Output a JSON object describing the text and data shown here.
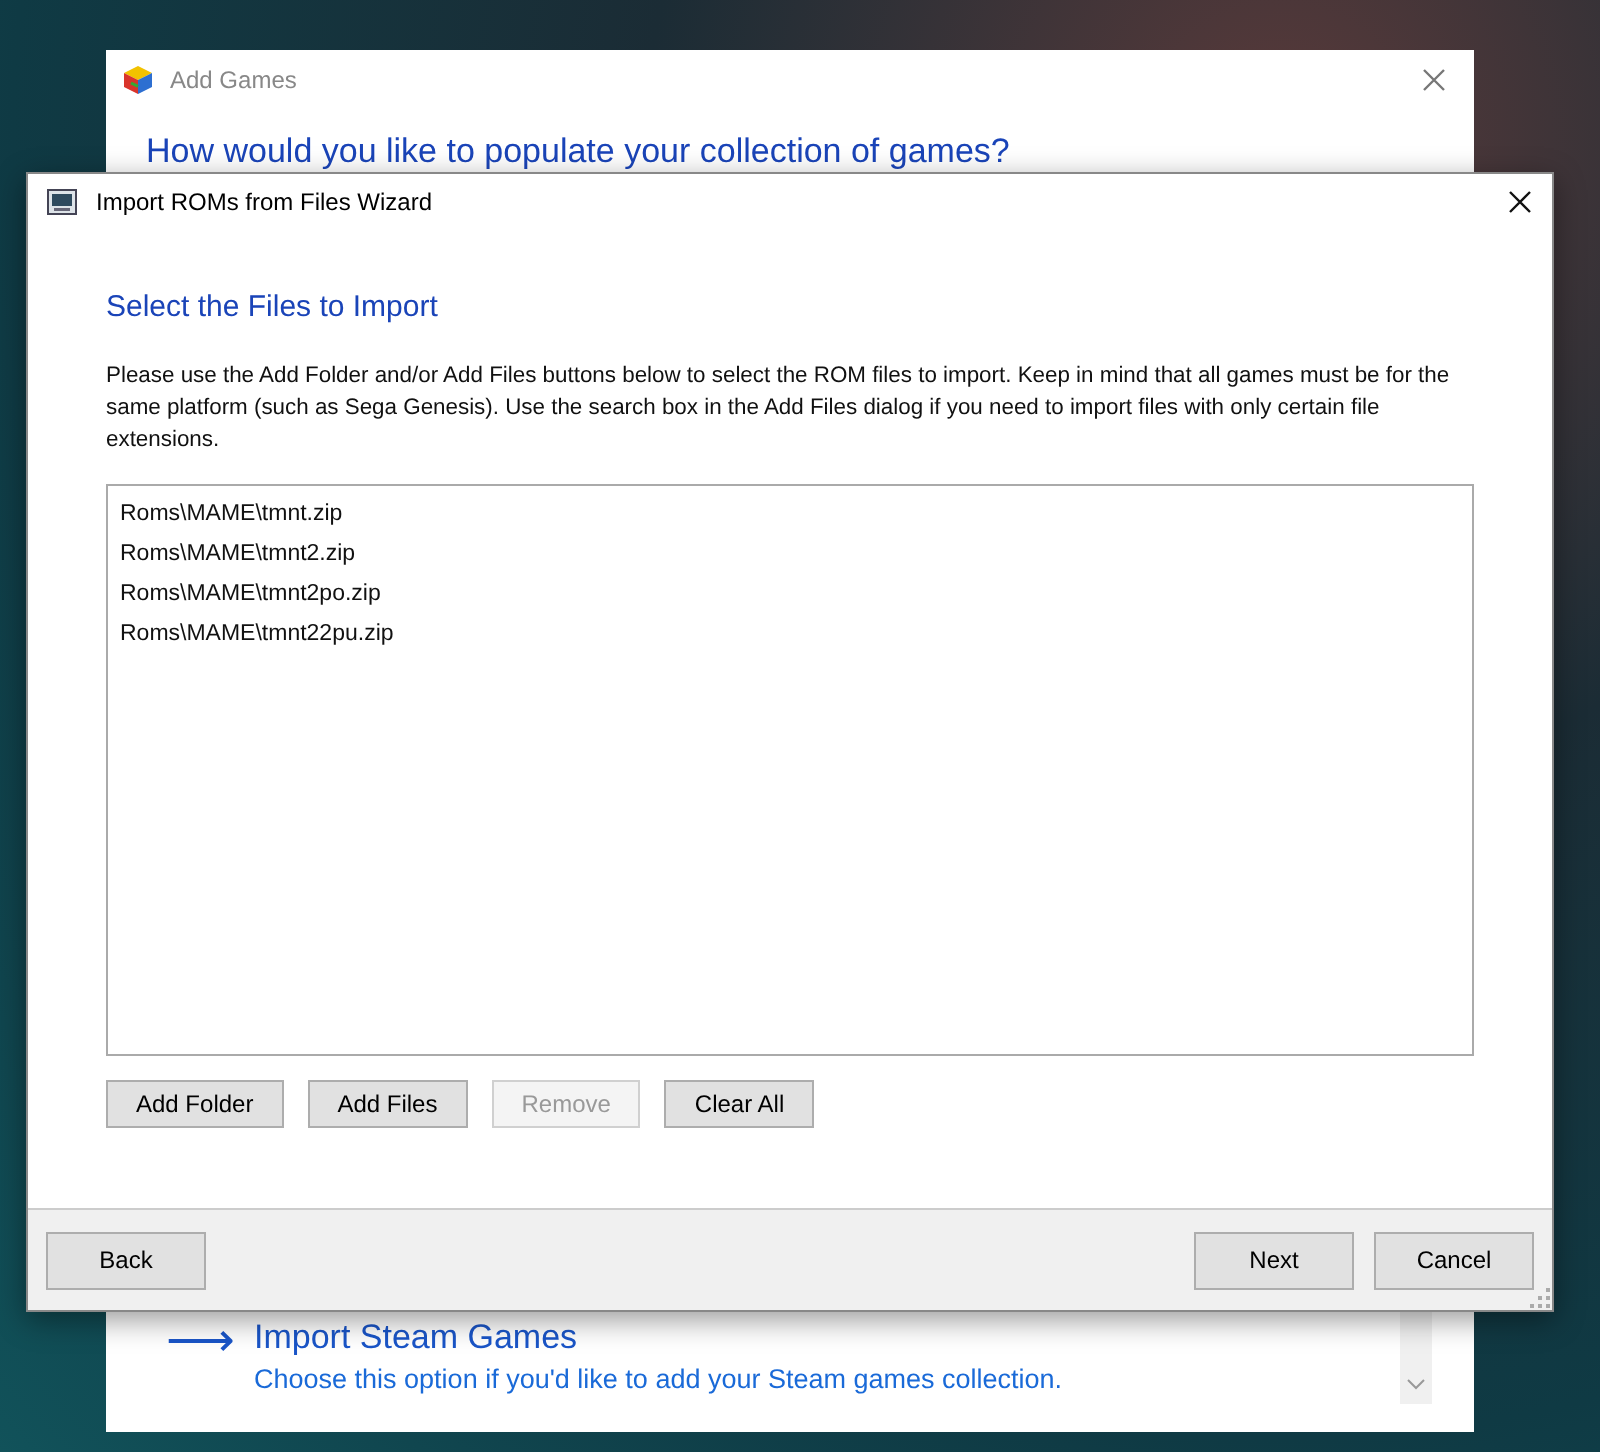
{
  "back_window": {
    "title": "Add Games",
    "heading": "How would you like to populate your collection of games?",
    "option": {
      "arrow": "⟶",
      "title": "Import Steam Games",
      "description": "Choose this option if you'd like to add your Steam games collection."
    }
  },
  "dialog": {
    "title": "Import ROMs from Files Wizard",
    "heading": "Select the Files to Import",
    "instructions": "Please use the Add Folder and/or Add Files buttons below to select the ROM files to import. Keep in mind that all games must be for the same platform (such as Sega Genesis). Use the search box in the Add Files dialog if you need to import files with only certain file extensions.",
    "files": [
      "Roms\\MAME\\tmnt.zip",
      "Roms\\MAME\\tmnt2.zip",
      "Roms\\MAME\\tmnt2po.zip",
      "Roms\\MAME\\tmnt22pu.zip"
    ],
    "buttons": [
      {
        "label": "Add Folder",
        "disabled": false
      },
      {
        "label": "Add Files",
        "disabled": false
      },
      {
        "label": "Remove",
        "disabled": true
      },
      {
        "label": "Clear All",
        "disabled": false
      }
    ],
    "footer_buttons": [
      {
        "label": "Back",
        "disabled": false
      },
      {
        "label": "Next",
        "disabled": false
      },
      {
        "label": "Cancel",
        "disabled": false
      }
    ]
  }
}
